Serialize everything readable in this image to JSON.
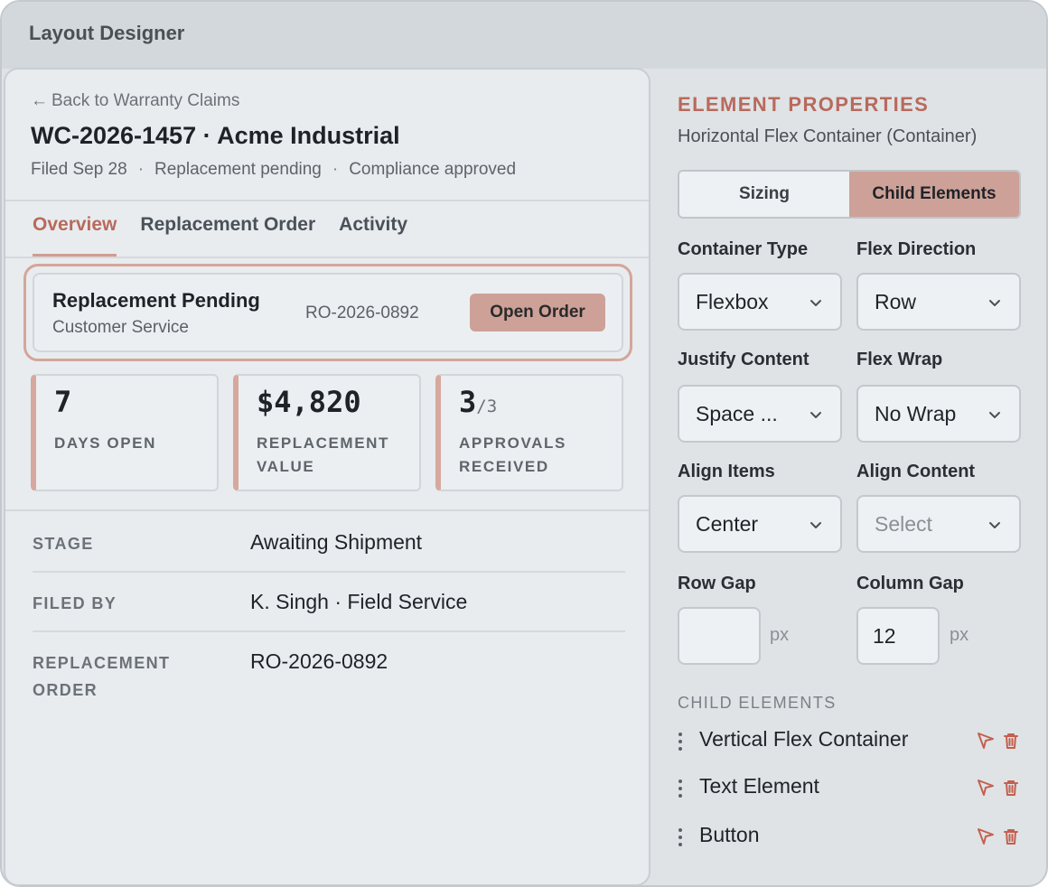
{
  "window": {
    "title": "Layout Designer"
  },
  "left": {
    "back_link": "Back to Warranty Claims",
    "back_arrow": "←",
    "claim_title": "WC-2026-1457 · Acme Industrial",
    "meta": [
      "Filed Sep 28",
      "Replacement pending",
      "Compliance approved"
    ],
    "meta_sep": "·",
    "tabs": [
      {
        "label": "Overview",
        "active": true
      },
      {
        "label": "Replacement Order",
        "active": false
      },
      {
        "label": "Activity",
        "active": false
      }
    ],
    "status": {
      "title": "Replacement Pending",
      "subtitle": "Customer Service",
      "reference": "RO-2026-0892",
      "button": "Open Order"
    },
    "stats": [
      {
        "value": "7",
        "label": "DAYS OPEN"
      },
      {
        "value": "$4,820",
        "label": "REPLACEMENT VALUE"
      },
      {
        "value": "3",
        "denominator": "/3",
        "label": "APPROVALS RECEIVED"
      }
    ],
    "details": [
      {
        "key": "STAGE",
        "value": "Awaiting Shipment"
      },
      {
        "key": "FILED BY",
        "value": "K. Singh · Field Service"
      },
      {
        "key": "REPLACEMENT ORDER",
        "value": "RO-2026-0892"
      }
    ]
  },
  "right": {
    "title": "ELEMENT PROPERTIES",
    "subtitle": "Horizontal Flex Container (Container)",
    "segments": [
      {
        "label": "Sizing",
        "active": false
      },
      {
        "label": "Child Elements",
        "active": true
      }
    ],
    "fields": {
      "container_type": {
        "label": "Container Type",
        "value": "Flexbox"
      },
      "flex_direction": {
        "label": "Flex Direction",
        "value": "Row"
      },
      "justify_content": {
        "label": "Justify Content",
        "value": "Space ..."
      },
      "flex_wrap": {
        "label": "Flex Wrap",
        "value": "No Wrap"
      },
      "align_items": {
        "label": "Align Items",
        "value": "Center"
      },
      "align_content": {
        "label": "Align Content",
        "value": "",
        "placeholder": "Select"
      },
      "row_gap": {
        "label": "Row Gap",
        "value": "",
        "unit": "px"
      },
      "column_gap": {
        "label": "Column Gap",
        "value": "12",
        "unit": "px"
      }
    },
    "child_elements_title": "CHILD ELEMENTS",
    "child_elements": [
      {
        "name": "Vertical Flex Container"
      },
      {
        "name": "Text Element"
      },
      {
        "name": "Button"
      }
    ],
    "icons": {
      "select": "cursor-arrow-icon",
      "delete": "trash-icon",
      "drag": "drag-handle-icon"
    },
    "accent_color": "#b86a5c",
    "accent_fill": "#cda198"
  }
}
